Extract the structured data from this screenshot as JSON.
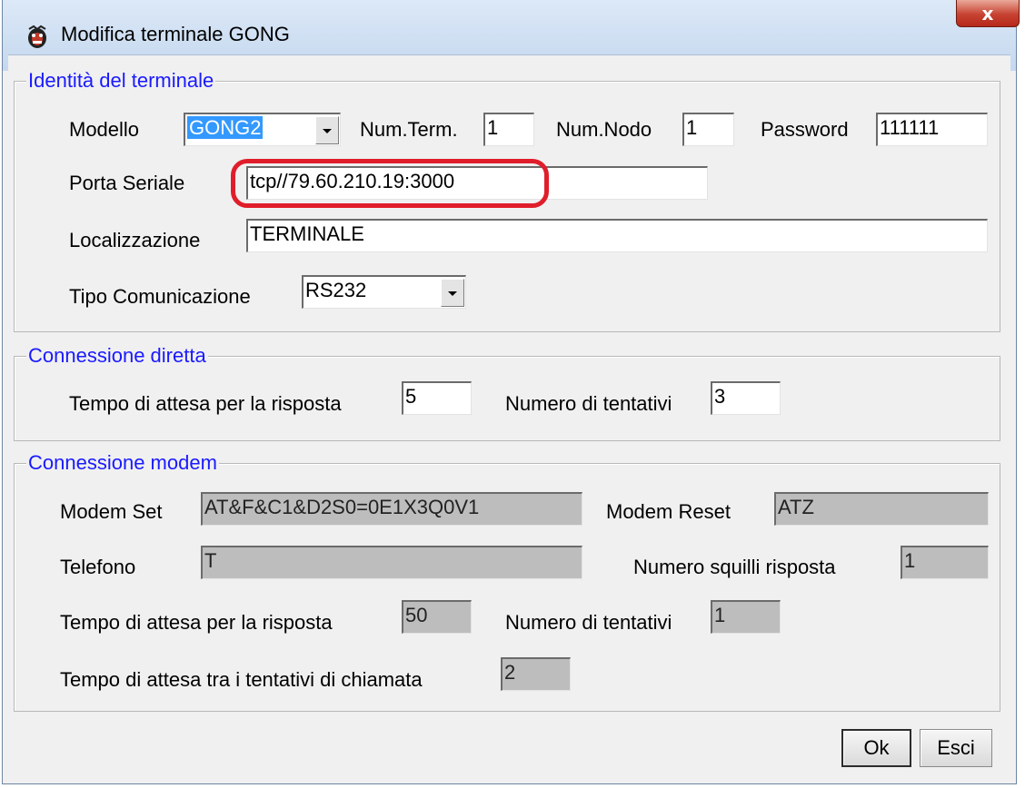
{
  "window": {
    "title": "Modifica terminale GONG",
    "close_label": "x"
  },
  "identity": {
    "legend": "Identità del terminale",
    "model_label": "Modello",
    "model_value": "GONG2",
    "num_term_label": "Num.Term.",
    "num_term_value": "1",
    "num_nodo_label": "Num.Nodo",
    "num_nodo_value": "1",
    "password_label": "Password",
    "password_value": "111111",
    "serial_label": "Porta Seriale",
    "serial_value": "tcp//79.60.210.19:3000",
    "location_label": "Localizzazione",
    "location_value": "TERMINALE",
    "comm_type_label": "Tipo Comunicazione",
    "comm_type_value": "RS232"
  },
  "direct": {
    "legend": "Connessione diretta",
    "wait_label": "Tempo di attesa per la risposta",
    "wait_value": "5",
    "attempts_label": "Numero di tentativi",
    "attempts_value": "3"
  },
  "modem": {
    "legend": "Connessione modem",
    "set_label": "Modem Set",
    "set_value": "AT&F&C1&D2S0=0E1X3Q0V1",
    "reset_label": "Modem Reset",
    "reset_value": "ATZ",
    "phone_label": "Telefono",
    "phone_value": "T",
    "rings_label": "Numero squilli risposta",
    "rings_value": "1",
    "wait_label": "Tempo di attesa per la risposta",
    "wait_value": "50",
    "attempts_label": "Numero di tentativi",
    "attempts_value": "1",
    "retry_wait_label": "Tempo di attesa tra i tentativi di chiamata",
    "retry_wait_value": "2"
  },
  "buttons": {
    "ok": "Ok",
    "exit": "Esci"
  },
  "colors": {
    "legend_text": "#1a1aff",
    "highlight_ring": "#e01e2b",
    "selection": "#3399ff",
    "disabled_field": "#bdbdbd"
  }
}
